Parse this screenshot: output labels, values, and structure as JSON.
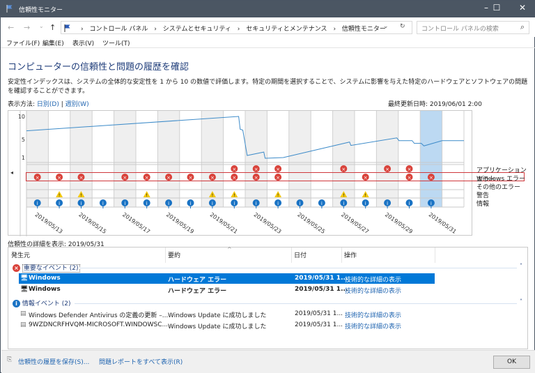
{
  "window": {
    "title": "信頼性モニター",
    "minimize": "–",
    "maximize": "☐",
    "close": "✕"
  },
  "address": {
    "back": "←",
    "forward": "→",
    "recent": "⌄",
    "up": "↑",
    "crumbs": [
      "コントロール パネル",
      "システムとセキュリティ",
      "セキュリティとメンテナンス",
      "信頼性モニター"
    ],
    "sep": "›",
    "dropdown": "⌄",
    "refresh": "↻",
    "search_placeholder": "コントロール パネルの検索",
    "search_icon": "⌕"
  },
  "menu": [
    "ファイル(F)",
    "編集(E)",
    "表示(V)",
    "ツール(T)"
  ],
  "heading": "コンピューターの信頼性と問題の履歴を確認",
  "description": "安定性インデックスは、システムの全体的な安定性を 1 から 10 の数値で評価します。特定の期間を選択することで、システムに影響を与えた特定のハードウェアとソフトウェアの問題を確認することができます。",
  "view": {
    "label": "表示方法:",
    "daily": "日別(D)",
    "sep": "|",
    "weekly": "週別(W)"
  },
  "last_updated": "最終更新日時: 2019/06/01 2:00",
  "chart_data": {
    "type": "line",
    "title": "信頼性モニター",
    "ylim": [
      0,
      10
    ],
    "yticks": [
      "10",
      "5",
      "1"
    ],
    "ytick_values": [
      10,
      5,
      1
    ],
    "days": [
      "2019/05/13",
      "2019/05/14",
      "2019/05/15",
      "2019/05/16",
      "2019/05/17",
      "2019/05/18",
      "2019/05/19",
      "2019/05/20",
      "2019/05/21",
      "2019/05/22",
      "2019/05/23",
      "2019/05/24",
      "2019/05/25",
      "2019/05/26",
      "2019/05/27",
      "2019/05/28",
      "2019/05/29",
      "2019/05/30",
      "2019/05/31",
      "2019/06/01"
    ],
    "xlabels": [
      "2019/05/13",
      "2019/05/15",
      "2019/05/17",
      "2019/05/19",
      "2019/05/21",
      "2019/05/23",
      "2019/05/25",
      "2019/05/27",
      "2019/05/29",
      "2019/05/31"
    ],
    "selected_day": "2019/05/31",
    "stability": [
      [
        -0.5,
        6.85
      ],
      [
        9.2,
        10
      ],
      [
        9.27,
        7.2
      ],
      [
        9.39,
        7.0
      ],
      [
        9.59,
        1.45
      ],
      [
        10.35,
        2.2
      ],
      [
        10.41,
        0.85
      ],
      [
        11.24,
        1.0
      ],
      [
        14.27,
        4.4
      ],
      [
        14.33,
        3.65
      ],
      [
        16.43,
        5.3
      ],
      [
        16.53,
        4.7
      ],
      [
        17.13,
        4.7
      ],
      [
        17.23,
        4.1
      ],
      [
        17.55,
        4.1
      ],
      [
        17.67,
        3.55
      ],
      [
        18.5,
        4.7
      ],
      [
        19.5,
        4.7
      ]
    ],
    "rows": [
      "アプリケーション エラー",
      "Windows エラー",
      "その他のエラー",
      "警告",
      "情報"
    ],
    "events": {
      "app_error": [
        0,
        0,
        0,
        0,
        0,
        0,
        0,
        0,
        0,
        1,
        1,
        1,
        0,
        0,
        1,
        0,
        1,
        1,
        0,
        0
      ],
      "windows_error": [
        1,
        1,
        1,
        0,
        1,
        1,
        1,
        1,
        1,
        1,
        1,
        1,
        0,
        0,
        0,
        1,
        0,
        1,
        1,
        0
      ],
      "other_error": [
        0,
        0,
        0,
        0,
        0,
        0,
        0,
        0,
        0,
        0,
        0,
        0,
        0,
        0,
        0,
        0,
        0,
        0,
        0,
        0
      ],
      "warning": [
        0,
        1,
        1,
        0,
        0,
        1,
        0,
        0,
        1,
        1,
        0,
        1,
        0,
        0,
        1,
        1,
        0,
        0,
        0,
        0
      ],
      "info": [
        1,
        1,
        1,
        1,
        1,
        1,
        1,
        1,
        1,
        1,
        1,
        1,
        1,
        1,
        1,
        1,
        1,
        1,
        1,
        0
      ]
    },
    "colors": {
      "line": "#3d8bc9",
      "error": "#d9423a",
      "warning": "#f2c811",
      "info": "#1a73c4",
      "selected": "#bcd9f2",
      "shade": "#efefef"
    }
  },
  "details": {
    "label": "信頼性の詳細を表示: 2019/05/31",
    "columns": [
      "発生元",
      "要約",
      "日付",
      "操作"
    ],
    "groups": [
      {
        "title": "重要なイベント (2)",
        "icon": "error-icon",
        "rows": [
          {
            "source": "Windows",
            "summary": "ハードウェア エラー",
            "date": "2019/05/31 1...",
            "action": "技術的な詳細の表示"
          },
          {
            "source": "Windows",
            "summary": "ハードウェア エラー",
            "date": "2019/05/31 1...",
            "action": "技術的な詳細の表示"
          }
        ]
      },
      {
        "title": "情報イベント (2)",
        "icon": "info-icon",
        "rows": [
          {
            "source": "Windows Defender Antivirus の定義の更新 –...",
            "summary": "Windows Update に成功しました",
            "date": "2019/05/31 1...",
            "action": "技術的な詳細の表示"
          },
          {
            "source": "9WZDNCRFHVQM-MICROSOFT.WINDOWSC...",
            "summary": "Windows Update に成功しました",
            "date": "2019/05/31 1...",
            "action": "技術的な詳細の表示"
          }
        ]
      }
    ]
  },
  "footer": {
    "save": "信頼性の履歴を保存(S)...",
    "all_reports": "問題レポートをすべて表示(R)",
    "ok": "OK"
  }
}
